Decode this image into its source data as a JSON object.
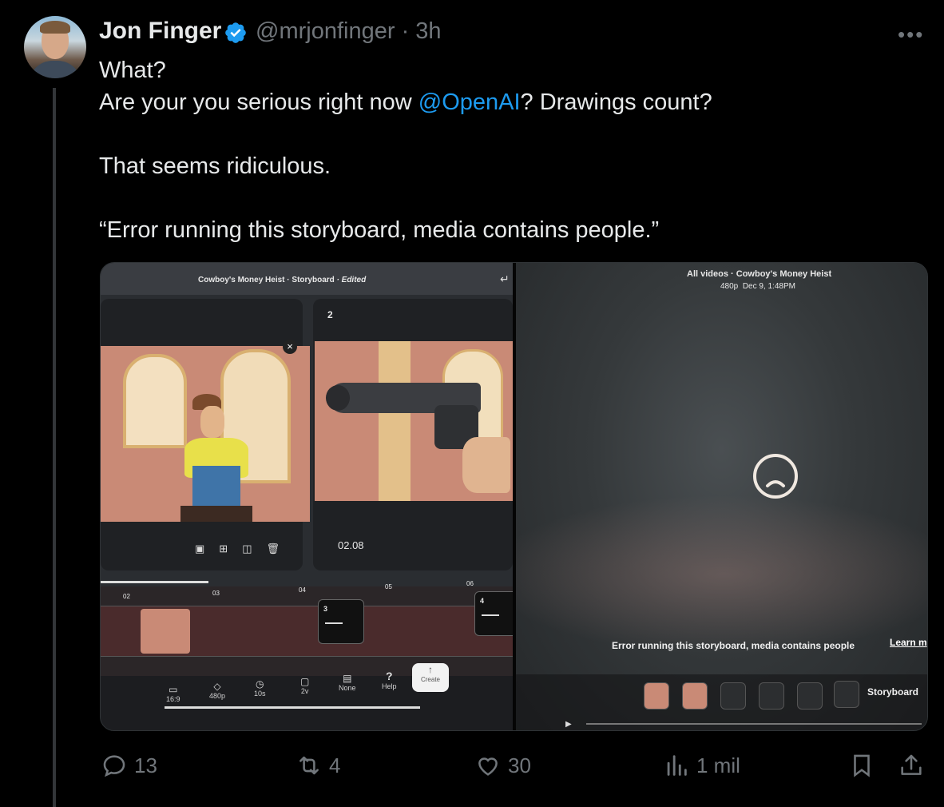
{
  "author": {
    "name": "Jon Finger",
    "handle": "@mrjonfinger",
    "time": "· 3h",
    "verified_color": "#1d9bf0"
  },
  "tweet": {
    "line1": "What?",
    "line2_pre": "Are your you serious right now ",
    "line2_mention": "@OpenAI",
    "line2_post": "? Drawings count?",
    "line3": "That seems ridiculous.",
    "line4": "“Error running this storyboard, media contains people.”"
  },
  "media_left": {
    "title": "Cowboy's Money Heist",
    "sep": "·",
    "storyboard": "Storyboard",
    "edited": "· Edited",
    "card2_number": "2",
    "card2_time": "02.08",
    "close_icon": "×",
    "timeline_marks": [
      "02",
      "03",
      "04",
      "05",
      "06"
    ],
    "clip3": "3",
    "clip4": "4",
    "toolbar": [
      {
        "icon": "aspect-icon",
        "label": "16:9"
      },
      {
        "icon": "diamond-icon",
        "label": "480p"
      },
      {
        "icon": "clock-icon",
        "label": "10s"
      },
      {
        "icon": "loop-icon",
        "label": "2v"
      },
      {
        "icon": "preset-icon",
        "label": "None"
      },
      {
        "icon": "help-icon",
        "label": "Help",
        "glyph": "?"
      }
    ],
    "create_label": "Create",
    "create_glyph": "↑"
  },
  "media_right": {
    "breadcrumb_all": "All videos",
    "breadcrumb_sep": "·",
    "breadcrumb_title": "Cowboy's Money Heist",
    "meta_res": "480p",
    "meta_date": "Dec 9, 1:48PM",
    "error_text": "Error running this storyboard, media contains people",
    "learn_more": "Learn m",
    "storyboard_label": "Storyboard"
  },
  "actions": {
    "replies": "13",
    "reposts": "4",
    "likes": "30",
    "views": "1 mil"
  },
  "colors": {
    "background": "#000000",
    "text": "#e7e9ea",
    "muted": "#71767b",
    "accent": "#1d9bf0"
  }
}
